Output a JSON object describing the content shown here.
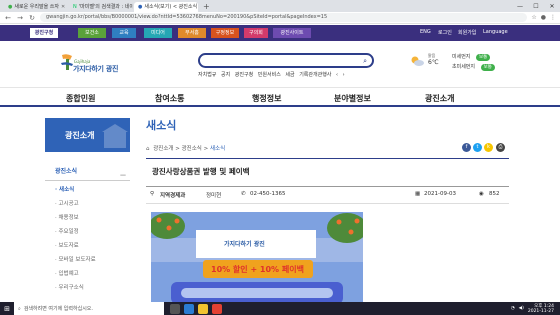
{
  "browser": {
    "tabs": [
      {
        "title": "새로운 우리말을 쓰자",
        "active": false
      },
      {
        "title": "'마미벨'의 검색결과 : 네이버 사...",
        "active": false
      },
      {
        "title": "새소식(보기) < 광진소식 > 광진...",
        "active": true
      }
    ],
    "new_tab": "+",
    "url": "gwangjin.go.kr/portal/bbs/B0000001/view.do?nttId=53602768menuNo=200190&pSiteId=portal&pageIndex=15"
  },
  "sitebar": {
    "items": [
      "광진구청",
      "보건소",
      "교육",
      "미디어",
      "부서홈",
      "구정정보",
      "구의회",
      "광진사이트"
    ],
    "right": [
      "ENG",
      "로그인",
      "회원가입",
      "Language"
    ]
  },
  "header": {
    "logo_sub": "Gajihaja",
    "logo_main": "가지다하기 광진",
    "search_placeholder": "",
    "keywords": [
      "자치법규",
      "공지",
      "광진구청",
      "민원서비스",
      "세금",
      "기록관개관행사"
    ],
    "weather_label": "맑음",
    "weather_temp": "6℃",
    "dust": [
      {
        "label": "미세먼지",
        "status": "보통"
      },
      {
        "label": "초미세먼지",
        "status": "보통"
      }
    ]
  },
  "mainnav": [
    "종합민원",
    "참여소통",
    "행정정보",
    "분야별정보",
    "광진소개"
  ],
  "sidebar": {
    "title": "광진소개",
    "section": "광진소식",
    "items": [
      "새소식",
      "고시공고",
      "채용정보",
      "주요일정",
      "보도자료",
      "모바일 보도자료",
      "입법예고",
      "우리구소식"
    ]
  },
  "content": {
    "page_title": "새소식",
    "breadcrumb": [
      "광진소개",
      "광진소식",
      "새소식"
    ],
    "post_title": "광진사랑상품권 발행 및 페이백",
    "dept": "지역경제과",
    "author": "정미현",
    "phone": "02-450-1365",
    "date": "2021-09-03",
    "views": "852",
    "poster_logo": "가지다하기 광진",
    "poster_banner": "10% 할인 + 10% 페이백"
  },
  "colors": {
    "site_bar": "#3a2f7e",
    "accent_blue": "#2f63b7",
    "navy": "#2d3e8a",
    "good_green": "#3fb04b"
  },
  "taskbar": {
    "search_text": "검색하려면 여기에 입력하십시오.",
    "time": "오후 1:24",
    "date": "2021-11-27"
  }
}
